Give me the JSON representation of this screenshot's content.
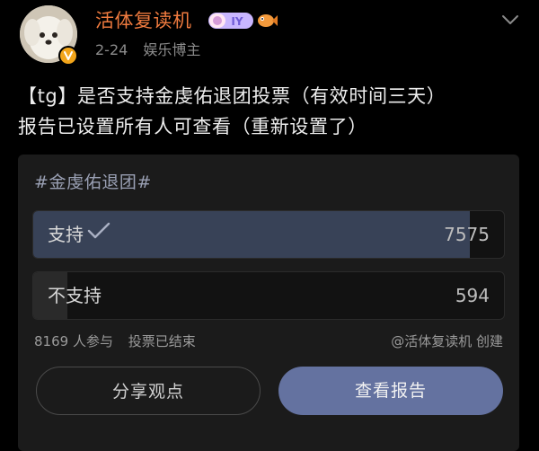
{
  "header": {
    "username": "活体复读机",
    "level_badge_text": "IY",
    "date": "2-24",
    "user_tag": "娱乐博主"
  },
  "post": {
    "line1": "【tg】是否支持金虔佑退团投票（有效时间三天）",
    "line2": "报告已设置所有人可查看（重新设置了）"
  },
  "poll": {
    "tag": "#金虔佑退团#",
    "options": [
      {
        "label": "支持",
        "count": "7575",
        "selected": true,
        "share": 0.927
      },
      {
        "label": "不支持",
        "count": "594",
        "selected": false,
        "share": 0.073
      }
    ],
    "participants": "8169 人参与",
    "status": "投票已结束",
    "creator": "@活体复读机 创建",
    "share_label": "分享观点",
    "report_label": "查看报告"
  },
  "colors": {
    "username": "#f07b3f",
    "verify_badge": "#f2a51a",
    "selected_fill": "#384257",
    "report_button": "#6472a0"
  },
  "icons": [
    "verified-badge-icon",
    "chevron-down-icon",
    "checkmark-icon",
    "level-badge-icon",
    "fish-icon"
  ]
}
